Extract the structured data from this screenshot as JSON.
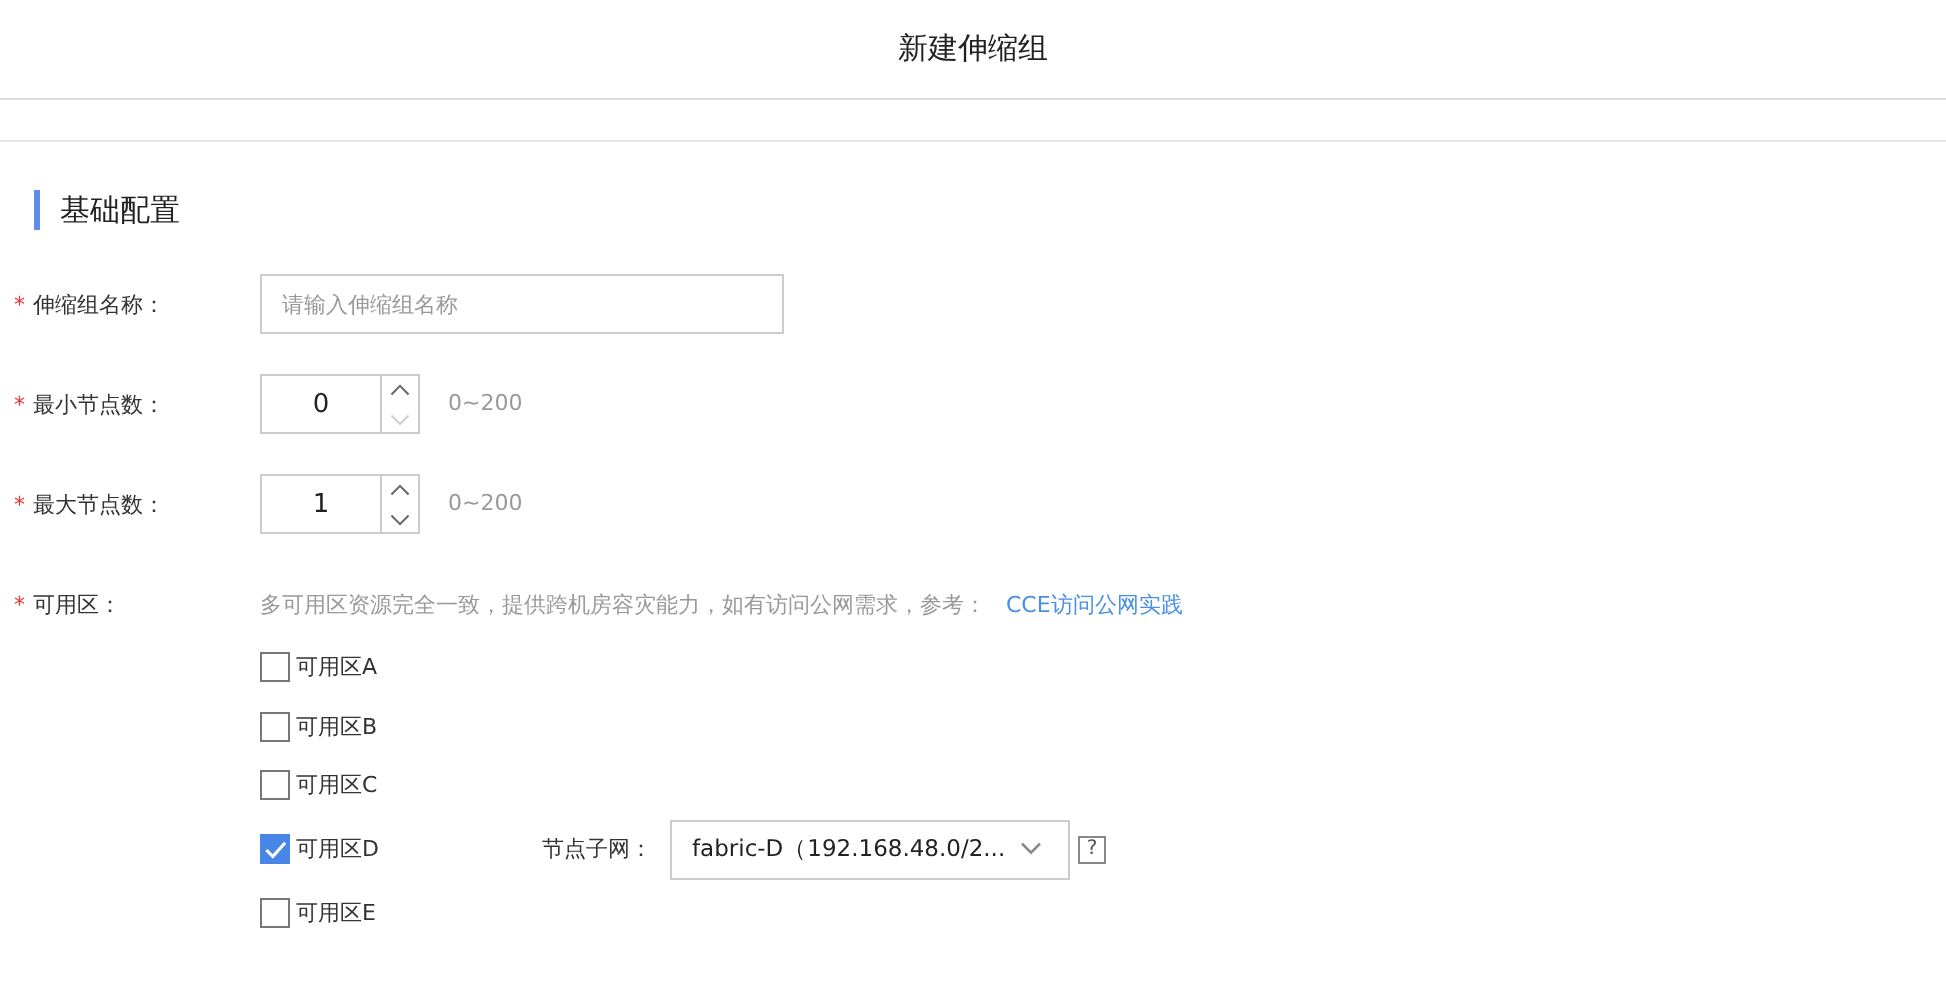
{
  "header": {
    "title": "新建伸缩组"
  },
  "section": {
    "title": "基础配置"
  },
  "fields": [
    {
      "kind": "text",
      "required_mark": "*",
      "label": "伸缩组名称：",
      "placeholder": "请输入伸缩组名称"
    },
    {
      "kind": "number",
      "required_mark": "*",
      "label": "最小节点数：",
      "value": "0",
      "range": "0~200",
      "up_disabled": false,
      "down_disabled": true
    },
    {
      "kind": "number",
      "required_mark": "*",
      "label": "最大节点数：",
      "value": "1",
      "range": "0~200",
      "up_disabled": false,
      "down_disabled": false
    },
    {
      "kind": "zones",
      "required_mark": "*",
      "label": "可用区：",
      "hint": "多可用区资源完全一致，提供跨机房容灾能力，如有访问公网需求，参考：",
      "link": "CCE访问公网实践",
      "zones": [
        {
          "label": "可用区A",
          "checked": false
        },
        {
          "label": "可用区B",
          "checked": false
        },
        {
          "label": "可用区C",
          "checked": false
        },
        {
          "label": "可用区D",
          "checked": true,
          "subnet_label": "节点子网：",
          "subnet_value": "fabric-D（192.168.48.0/2...",
          "help": "?"
        },
        {
          "label": "可用区E",
          "checked": false
        }
      ]
    }
  ]
}
